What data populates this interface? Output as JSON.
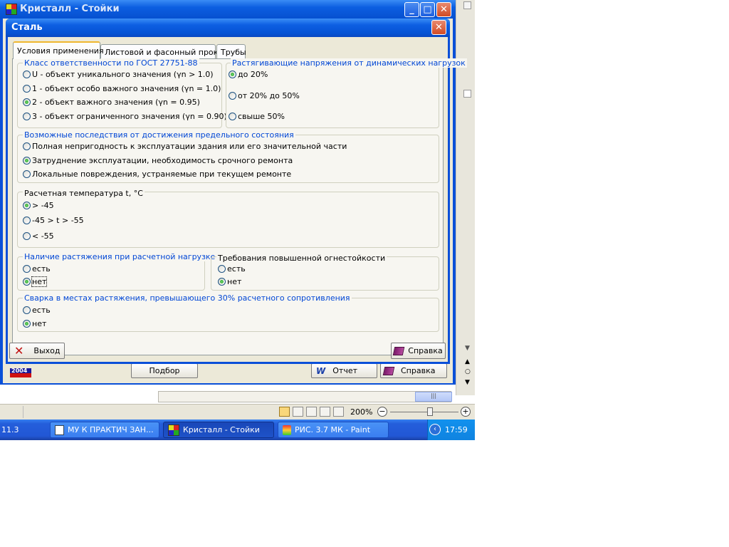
{
  "bg_window": {
    "title": "Кристалл - Стойки",
    "buttons": {
      "select": "Подбор",
      "report": "Отчет",
      "help": "Справка"
    },
    "year_badge": "2004"
  },
  "dialog": {
    "title": "Сталь",
    "tabs": [
      "Условия применения",
      "Листовой и фасонный прокат",
      "Трубы"
    ],
    "responsibility": {
      "legend": "Класс ответственности по ГОСТ 27751-88",
      "options": [
        "U - объект уникального значения (γn > 1.0)",
        "1 - объект особо важного значения (γn = 1.0)",
        "2 - объект важного значения (γn = 0.95)",
        "3 - объект ограниченного значения (γn = 0.90)"
      ],
      "selected": 2
    },
    "tensile": {
      "legend": "Растягивающие напряжения от динамических нагрузок",
      "options": [
        "до 20%",
        "от 20% до 50%",
        "свыше 50%"
      ],
      "selected": 0
    },
    "consequences": {
      "legend": "Возможные последствия от достижения предельного состояния",
      "options": [
        "Полная непригодность к эксплуатации здания или его значительной части",
        "Затруднение эксплуатации, необходимость срочного ремонта",
        "Локальные повреждения, устраняемые при текущем ремонте"
      ],
      "selected": 1
    },
    "temperature": {
      "legend": "Расчетная температура t, °C",
      "options": [
        "> -45",
        "-45 > t > -55",
        "< -55"
      ],
      "selected": 0
    },
    "tension_presence": {
      "legend": "Наличие растяжения при расчетной нагрузке",
      "options": [
        "есть",
        "нет"
      ],
      "selected": 1
    },
    "fire_resistance": {
      "legend": "Требования повышенной огнестойкости",
      "options": [
        "есть",
        "нет"
      ],
      "selected": 1
    },
    "welding": {
      "legend": "Сварка в местах растяжения, превышающего 30% расчетного сопротивления",
      "options": [
        "есть",
        "нет"
      ],
      "selected": 1
    },
    "buttons": {
      "exit": "Выход",
      "help": "Справка"
    }
  },
  "statusbar": {
    "zoom": "200%"
  },
  "taskbar": {
    "left_item": "11.3",
    "items": [
      "МУ К ПРАКТИЧ ЗАН...",
      "Кристалл - Стойки",
      "РИС. 3.7 МК - Paint"
    ],
    "active_index": 1,
    "clock": "17:59"
  },
  "colors": {
    "xp_blue": "#0a4fd8",
    "legend_blue": "#0046d5",
    "dialog_bg": "#ece9d8"
  }
}
